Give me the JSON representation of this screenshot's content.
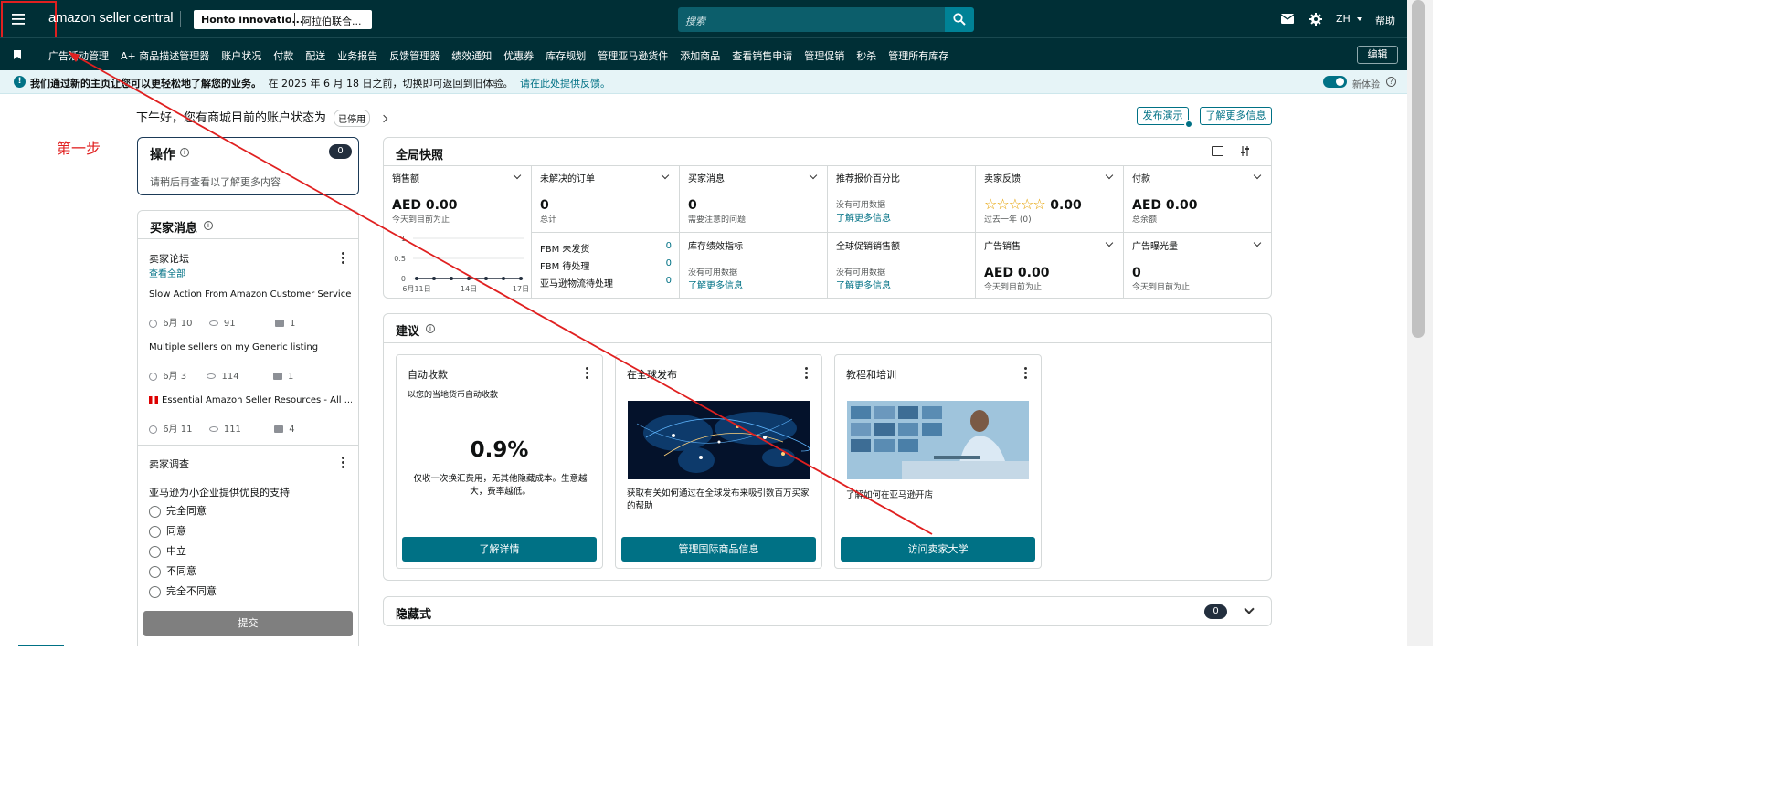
{
  "topbar": {
    "logo": "amazon seller central",
    "store_name": "Honto innovatio...",
    "marketplace": "阿拉伯联合...",
    "search_placeholder": "搜索",
    "language": "ZH",
    "help": "帮助"
  },
  "nav": {
    "items": [
      "广告活动管理",
      "A+ 商品描述管理器",
      "账户状况",
      "付款",
      "配送",
      "业务报告",
      "反馈管理器",
      "绩效通知",
      "优惠券",
      "库存规划",
      "管理亚马逊货件",
      "添加商品",
      "查看销售申请",
      "管理促销",
      "秒杀",
      "管理所有库存"
    ],
    "edit": "编辑"
  },
  "notice": {
    "bold": "我们通过新的主页让您可以更轻松地了解您的业务。",
    "text": "在 2025 年 6 月 18 日之前，切换即可返回到旧体验。",
    "link": "请在此处提供反馈。",
    "toggle_label": "新体验"
  },
  "greeting": {
    "text": "下午好，您有商城目前的账户状态为",
    "status": "已停用",
    "publish_demo": "发布演示",
    "learn_more": "了解更多信息"
  },
  "annotation": {
    "step": "第一步",
    "color": "#e02020"
  },
  "actions": {
    "title": "操作",
    "count": "0",
    "message": "请稍后再查看以了解更多内容"
  },
  "buyer_messages": {
    "title": "买家消息",
    "forum": {
      "title": "卖家论坛",
      "view_all": "查看全部",
      "posts": [
        {
          "title": "Slow Action From Amazon Customer Service",
          "date": "6月 10",
          "views": "91",
          "comments": "1"
        },
        {
          "title": "Multiple sellers on my Generic listing",
          "date": "6月 3",
          "views": "114",
          "comments": "1"
        },
        {
          "title": "Essential Amazon Seller Resources - All ...",
          "date": "6月 11",
          "views": "111",
          "comments": "4"
        }
      ]
    },
    "survey": {
      "title": "卖家调查",
      "question": "亚马逊为小企业提供优良的支持",
      "options": [
        "完全同意",
        "同意",
        "中立",
        "不同意",
        "完全不同意"
      ],
      "submit": "提交"
    }
  },
  "snapshot": {
    "title": "全局快照",
    "sales": {
      "label": "销售额",
      "value": "AED 0.00",
      "sub": "今天到目前为止"
    },
    "orders": {
      "label": "未解决的订单",
      "value": "0",
      "sub": "总计",
      "rows": [
        {
          "label": "FBM 未发货",
          "value": "0"
        },
        {
          "label": "FBM 待处理",
          "value": "0"
        },
        {
          "label": "亚马逊物流待处理",
          "value": "0"
        }
      ]
    },
    "buyer_msgs": {
      "label": "买家消息",
      "value": "0",
      "sub": "需要注意的问题"
    },
    "featured_offer": {
      "label": "推荐报价百分比",
      "no_data": "没有可用数据",
      "link": "了解更多信息"
    },
    "feedback": {
      "label": "卖家反馈",
      "value": "0.00",
      "sub": "过去一年 (0)"
    },
    "payments": {
      "label": "付款",
      "value": "AED 0.00",
      "sub": "总余额"
    },
    "inventory": {
      "label": "库存绩效指标",
      "no_data": "没有可用数据",
      "link": "了解更多信息"
    },
    "global_promo": {
      "label": "全球促销销售额",
      "no_data": "没有可用数据",
      "link": "了解更多信息"
    },
    "ad_sales": {
      "label": "广告销售",
      "value": "AED 0.00",
      "sub": "今天到目前为止"
    },
    "ad_impressions": {
      "label": "广告曝光量",
      "value": "0",
      "sub": "今天到目前为止"
    }
  },
  "chart_data": {
    "type": "line",
    "title": "",
    "x": [
      "6月11日",
      "6月12日",
      "6月13日",
      "6月14日",
      "6月15日",
      "6月16日",
      "6月17日"
    ],
    "xticks": [
      "6月11日",
      "14日",
      "17日"
    ],
    "series": [
      {
        "values": [
          0,
          0,
          0,
          0,
          0,
          0,
          0
        ]
      }
    ],
    "yticks": [
      "1",
      "0.5",
      "0"
    ],
    "ylim": [
      0,
      1
    ]
  },
  "suggestions": {
    "title": "建议",
    "cards": [
      {
        "title": "自动收款",
        "subtitle": "以您的当地货币自动收款",
        "rate": "0.9%",
        "desc": "仅收一次换汇费用，无其他隐藏成本。生意越大，费率越低。",
        "button": "了解详情"
      },
      {
        "title": "在全球发布",
        "desc": "获取有关如何通过在全球发布来吸引数百万买家的帮助",
        "button": "管理国际商品信息"
      },
      {
        "title": "教程和培训",
        "desc": "了解如何在亚马逊开店",
        "button": "访问卖家大学"
      }
    ]
  },
  "hidden": {
    "title": "隐藏式",
    "count": "0"
  }
}
